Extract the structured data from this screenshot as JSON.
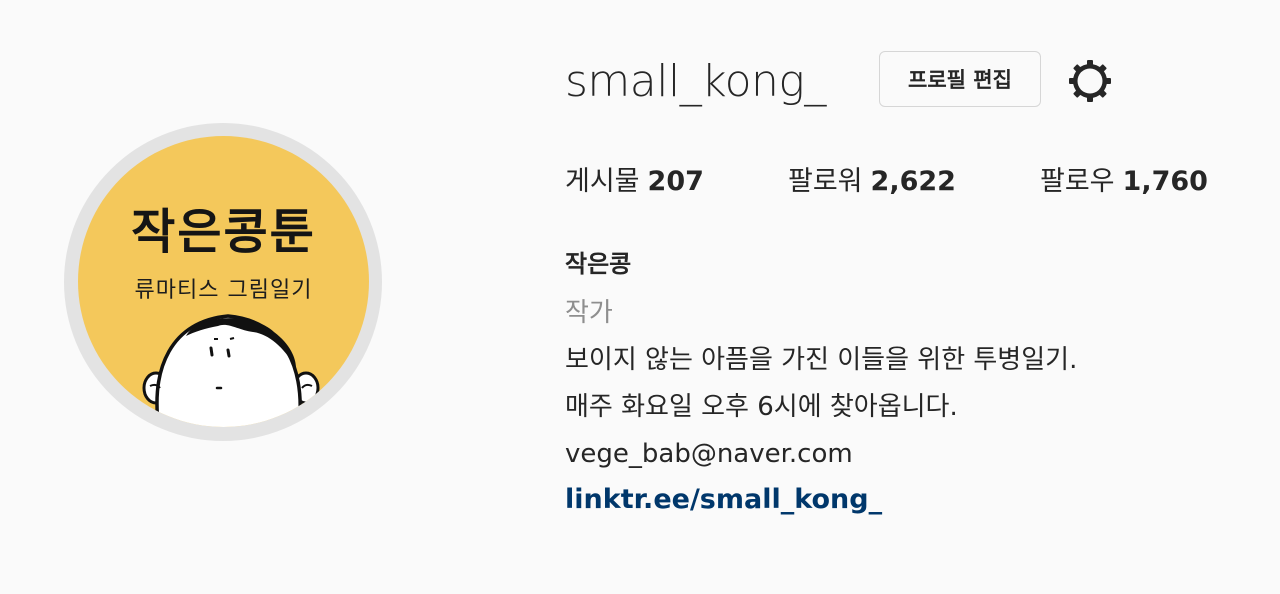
{
  "profile": {
    "username": "small_kong_",
    "edit_button_label": "프로필 편집",
    "settings_icon": "gear-icon"
  },
  "avatar": {
    "title": "작은콩툰",
    "subtitle": "류마티스 그림일기",
    "background_color": "#f4c85b"
  },
  "stats": [
    {
      "label": "게시물",
      "value": "207"
    },
    {
      "label": "팔로워",
      "value": "2,622"
    },
    {
      "label": "팔로우",
      "value": "1,760"
    }
  ],
  "bio": {
    "name": "작은콩",
    "category": "작가",
    "lines": [
      "보이지 않는 아픔을 가진 이들을 위한 투병일기.",
      "매주 화요일 오후 6시에 찾아옵니다."
    ],
    "email": "vege_bab@naver.com",
    "link": "linktr.ee/small_kong_",
    "link_color": "#00376b"
  }
}
